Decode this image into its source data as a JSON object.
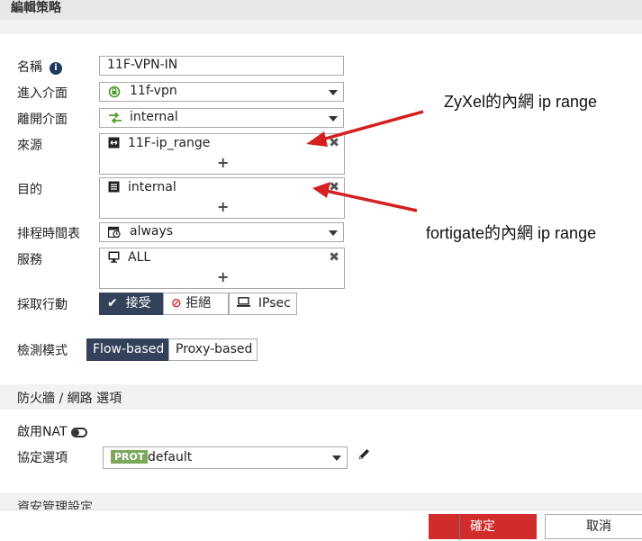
{
  "window": {
    "title": "編輯策略"
  },
  "form": {
    "name_label": "名稱",
    "name_value": "11F-VPN-IN",
    "incoming_label": "進入介面",
    "incoming_value": "11f-vpn",
    "outgoing_label": "離開介面",
    "outgoing_value": "internal",
    "source_label": "來源",
    "source_value": "11F-ip_range",
    "dest_label": "目的",
    "dest_value": "internal",
    "schedule_label": "排程時間表",
    "schedule_value": "always",
    "service_label": "服務",
    "service_value": "ALL",
    "action_label": "採取行動",
    "action_accept": "接受",
    "action_deny": "拒絕",
    "action_ipsec": "IPsec",
    "inspection_label": "檢測模式",
    "inspection_flow": "Flow-based",
    "inspection_proxy": "Proxy-based"
  },
  "firewall_section": {
    "title": "防火牆 / 網路 選項",
    "nat_label": "啟用NAT",
    "protocol_label": "協定選項",
    "protocol_badge": "PROT",
    "protocol_value": "default"
  },
  "lower_section": {
    "title": "資安管理設定"
  },
  "annotations": {
    "zyxel": "ZyXel的內網 ip range",
    "fortigate": "fortigate的內網 ip range",
    "arrow_color": "#d42020"
  },
  "footer": {
    "ok": "確定",
    "cancel": "取消"
  },
  "colors": {
    "accent": "#34415a",
    "ok_button": "#d12c2c",
    "prot_badge": "#7ba85b"
  }
}
